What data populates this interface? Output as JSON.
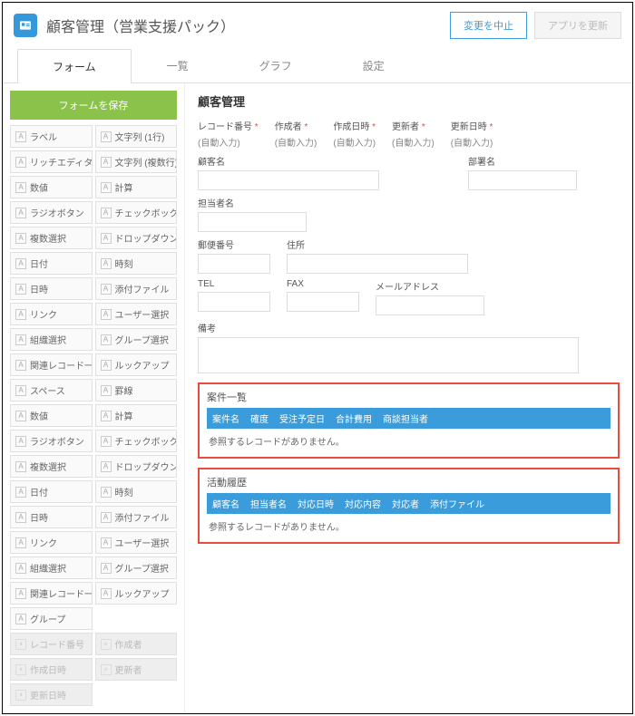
{
  "header": {
    "title": "顧客管理（営業支援パック）",
    "cancel": "変更を中止",
    "update": "アプリを更新"
  },
  "tabs": [
    "フォーム",
    "一覧",
    "グラフ",
    "設定"
  ],
  "sidebar": {
    "save": "フォームを保存",
    "fields": [
      "ラベル",
      "文字列 (1行)",
      "リッチエディター",
      "文字列 (複数行)",
      "数値",
      "計算",
      "ラジオボタン",
      "チェックボックス",
      "複数選択",
      "ドロップダウン",
      "日付",
      "時刻",
      "日時",
      "添付ファイル",
      "リンク",
      "ユーザー選択",
      "組織選択",
      "グループ選択",
      "関連レコード一覧",
      "ルックアップ",
      "スペース",
      "罫線",
      "数値",
      "計算",
      "ラジオボタン",
      "チェックボックス",
      "複数選択",
      "ドロップダウン",
      "日付",
      "時刻",
      "日時",
      "添付ファイル",
      "リンク",
      "ユーザー選択",
      "組織選択",
      "グループ選択",
      "関連レコード一覧",
      "ルックアップ",
      "グループ",
      ""
    ],
    "bottom": [
      "レコード番号",
      "作成者",
      "作成日時",
      "更新者",
      "更新日時",
      ""
    ]
  },
  "form": {
    "title": "顧客管理",
    "auto_fields": [
      {
        "label": "レコード番号",
        "value": "(自動入力)"
      },
      {
        "label": "作成者",
        "value": "(自動入力)"
      },
      {
        "label": "作成日時",
        "value": "(自動入力)"
      },
      {
        "label": "更新者",
        "value": "(自動入力)"
      },
      {
        "label": "更新日時",
        "value": "(自動入力)"
      }
    ],
    "labels": {
      "customer": "顧客名",
      "dept": "部署名",
      "contact": "担当者名",
      "postal": "郵便番号",
      "address": "住所",
      "tel": "TEL",
      "fax": "FAX",
      "email": "メールアドレス",
      "notes": "備考"
    },
    "related1": {
      "title": "案件一覧",
      "cols": [
        "案件名",
        "確度",
        "受注予定日",
        "合計費用",
        "商談担当者"
      ],
      "empty": "参照するレコードがありません。"
    },
    "related2": {
      "title": "活動履歴",
      "cols": [
        "顧客名",
        "担当者名",
        "対応日時",
        "対応内容",
        "対応者",
        "添付ファイル"
      ],
      "empty": "参照するレコードがありません。"
    }
  }
}
